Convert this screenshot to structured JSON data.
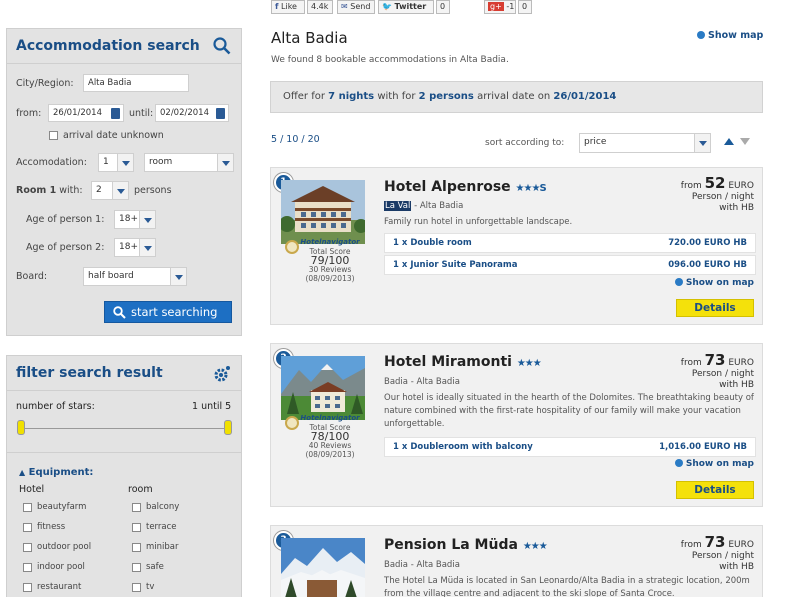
{
  "social": {
    "like": "Like",
    "like_count": "4.4k",
    "send": "Send",
    "twitter": "Twitter",
    "twitter_count": "0",
    "gplus_count": "-1",
    "gplus_extra": "0"
  },
  "search": {
    "title": "Accommodation search",
    "city_label": "City/Region:",
    "city_value": "Alta Badia",
    "from_label": "from:",
    "from_value": "26/01/2014",
    "until_label": "until:",
    "until_value": "02/02/2014",
    "unknown_label": "arrival date unknown",
    "accommodation_label": "Accomodation:",
    "accommodation_count": "1",
    "accommodation_type": "room",
    "room_label": "Room 1",
    "with_label": "with:",
    "persons_value": "2",
    "persons_label": "persons",
    "age1_label": "Age of person 1:",
    "age1_value": "18+",
    "age2_label": "Age of person 2:",
    "age2_value": "18+",
    "board_label": "Board:",
    "board_value": "half board",
    "button": "start searching"
  },
  "filter": {
    "title": "filter search result",
    "stars_label": "number of stars:",
    "stars_range": "1 until 5",
    "equipment_label": "Equipment:",
    "col_hotel": "Hotel",
    "col_room": "room",
    "hotel_items": [
      "beautyfarm",
      "fitness",
      "outdoor pool",
      "indoor pool",
      "restaurant"
    ],
    "room_items": [
      "balcony",
      "terrace",
      "minibar",
      "safe",
      "tv"
    ]
  },
  "main": {
    "title": "Alta Badia",
    "show_map": "Show map",
    "found": "We found 8 bookable accommodations in Alta Badia.",
    "offer_pre": "Offer for",
    "offer_nights": "7 nights",
    "offer_mid": "with for",
    "offer_persons": "2 persons",
    "offer_arr": "arrival date on",
    "offer_date": "26/01/2014",
    "pagination": "5 / 10 / 20",
    "sort_label": "sort according to:",
    "sort_value": "price"
  },
  "hotels": [
    {
      "num": "1",
      "name": "Hotel Alpenrose",
      "stars": "★★★S",
      "loc_hl": "La Val",
      "loc": " - Alta Badia",
      "desc": "Family run hotel in unforgettable landscape.",
      "from": "from",
      "price": "52",
      "cur": "EURO",
      "per": "Person / night",
      "board": "with HB",
      "rooms": [
        {
          "name": "1 x Double room",
          "price": "720.00 EURO HB"
        },
        {
          "name": "1 x Junior Suite Panorama",
          "price": "096.00 EURO HB"
        }
      ],
      "nav_brand": "Hotelnavigator",
      "nav_total": "Total Score",
      "nav_score": "79/100",
      "nav_reviews": "30 Reviews",
      "nav_date": "(08/09/2013)",
      "show_map": "Show on map",
      "details": "Details"
    },
    {
      "num": "2",
      "name": "Hotel Miramonti",
      "stars": "★★★",
      "loc": "Badia - Alta Badia",
      "desc": "Our hotel is ideally situated in the hearth of the Dolomites. The breathtaking beauty of nature combined with the first-rate hospitality of our family will make your vacation unforgettable.",
      "from": "from",
      "price": "73",
      "cur": "EURO",
      "per": "Person / night",
      "board": "with HB",
      "rooms": [
        {
          "name": "1 x Doubleroom with balcony",
          "price": "1,016.00 EURO HB"
        }
      ],
      "nav_brand": "Hotelnavigator",
      "nav_total": "Total Score",
      "nav_score": "78/100",
      "nav_reviews": "40 Reviews",
      "nav_date": "(08/09/2013)",
      "show_map": "Show on map",
      "details": "Details"
    },
    {
      "num": "3",
      "name": "Pension La Müda",
      "stars": "★★★",
      "loc": "Badia - Alta Badia",
      "desc": "The Hotel La Müda is located in San Leonardo/Alta Badia in a strategic location, 200m from the village centre and adjacent to the ski slope of Santa Croce.",
      "from": "from",
      "price": "73",
      "cur": "EURO",
      "per": "Person / night",
      "board": "with HB"
    }
  ],
  "colors": {
    "brand_blue": "#1a4e86",
    "button_blue": "#1d6fc3",
    "details_yellow": "#f4e10b"
  }
}
